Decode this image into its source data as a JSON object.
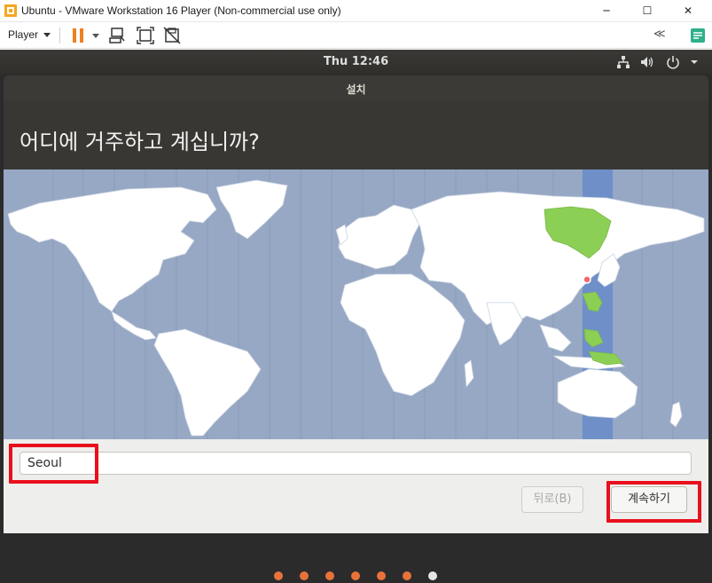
{
  "window": {
    "title": "Ubuntu - VMware Workstation 16 Player (Non-commercial use only)",
    "minimize": "─",
    "maximize": "☐",
    "close": "✕"
  },
  "toolbar": {
    "player_menu": "Player",
    "icons": [
      "pause-icon",
      "send-ctrl-alt-del-icon",
      "fit-guest-icon",
      "unity-icon",
      "collapse-icon",
      "notes-icon"
    ],
    "collapse_glyph": "≪"
  },
  "ubuntu": {
    "clock": "Thu 12:46",
    "status_icons": [
      "network-icon",
      "volume-icon",
      "power-icon",
      "menu-caret-icon"
    ]
  },
  "installer": {
    "title": "설치",
    "question": "어디에 거주하고 계십니까?",
    "city_value": "Seoul",
    "back_label": "뒤로(B)",
    "continue_label": "계속하기",
    "progress_total": 7,
    "progress_current": 7
  },
  "colors": {
    "ocean": "#97a8c4",
    "land": "#ffffff",
    "selected_zone": "#6f8fc9",
    "zone_land": "#8ccf55",
    "accent": "#e8733a",
    "highlight": "#e8101b"
  }
}
